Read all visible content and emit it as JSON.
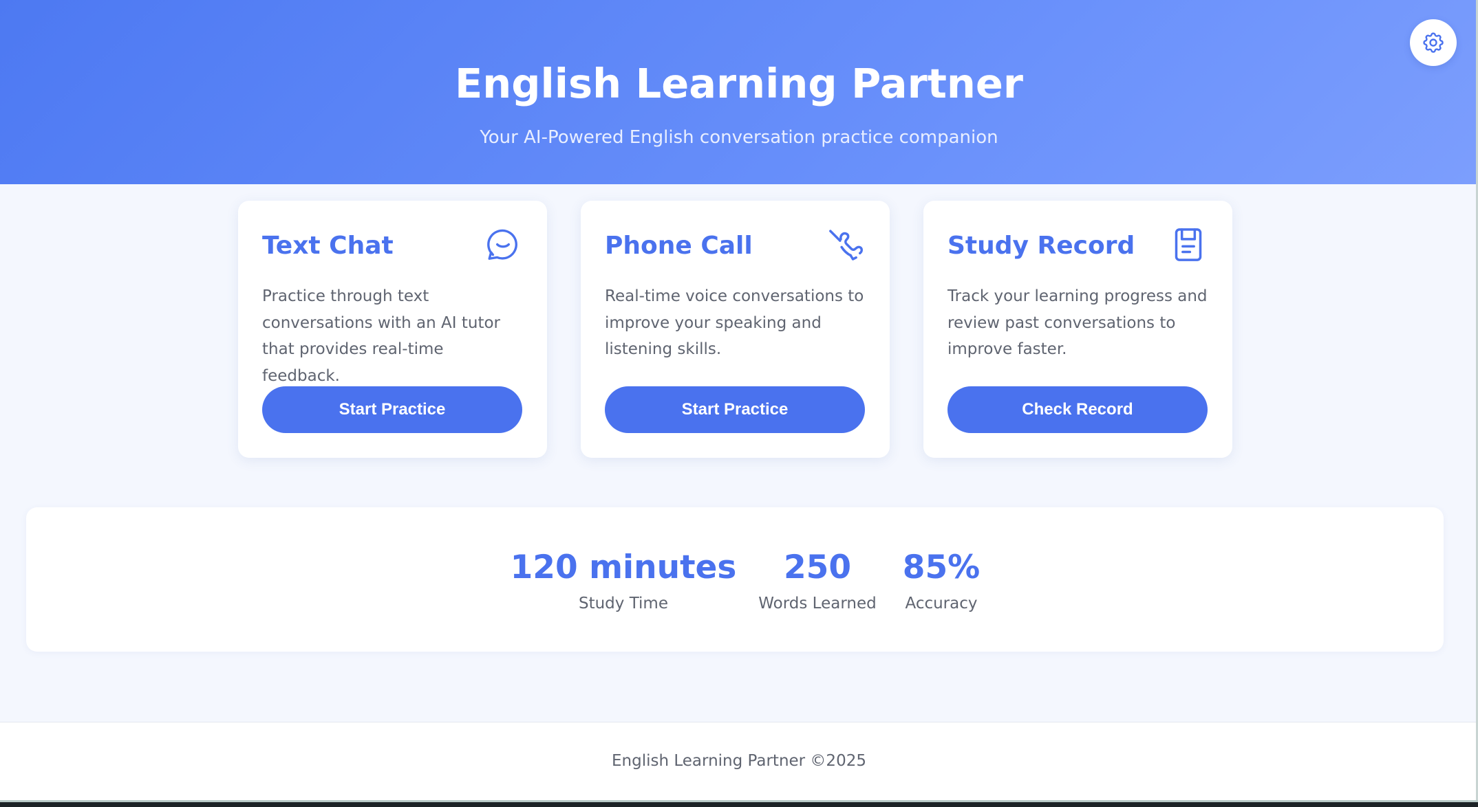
{
  "header": {
    "title": "English Learning Partner",
    "subtitle": "Your AI-Powered English conversation practice companion",
    "settings_icon": "gear-icon"
  },
  "cards": [
    {
      "title": "Text Chat",
      "icon": "chat-bubble-icon",
      "description": "Practice through text conversations with an AI tutor that provides real-time feedback.",
      "button_label": "Start Practice"
    },
    {
      "title": "Phone Call",
      "icon": "phone-call-icon",
      "description": "Real-time voice conversations to improve your speaking and listening skills.",
      "button_label": "Start Practice"
    },
    {
      "title": "Study Record",
      "icon": "record-document-icon",
      "description": "Track your learning progress and review past conversations to improve faster.",
      "button_label": "Check Record"
    }
  ],
  "stats": [
    {
      "value": "120 minutes",
      "label": "Study Time"
    },
    {
      "value": "250",
      "label": "Words Learned"
    },
    {
      "value": "85%",
      "label": "Accuracy"
    }
  ],
  "footer": {
    "text": "English Learning Partner ©2025"
  },
  "colors": {
    "accent": "#4a72ee",
    "header_gradient_start": "#4d79f2",
    "header_gradient_end": "#7c9efd",
    "page_background": "#f4f7fe",
    "body_text": "#5f6470"
  }
}
